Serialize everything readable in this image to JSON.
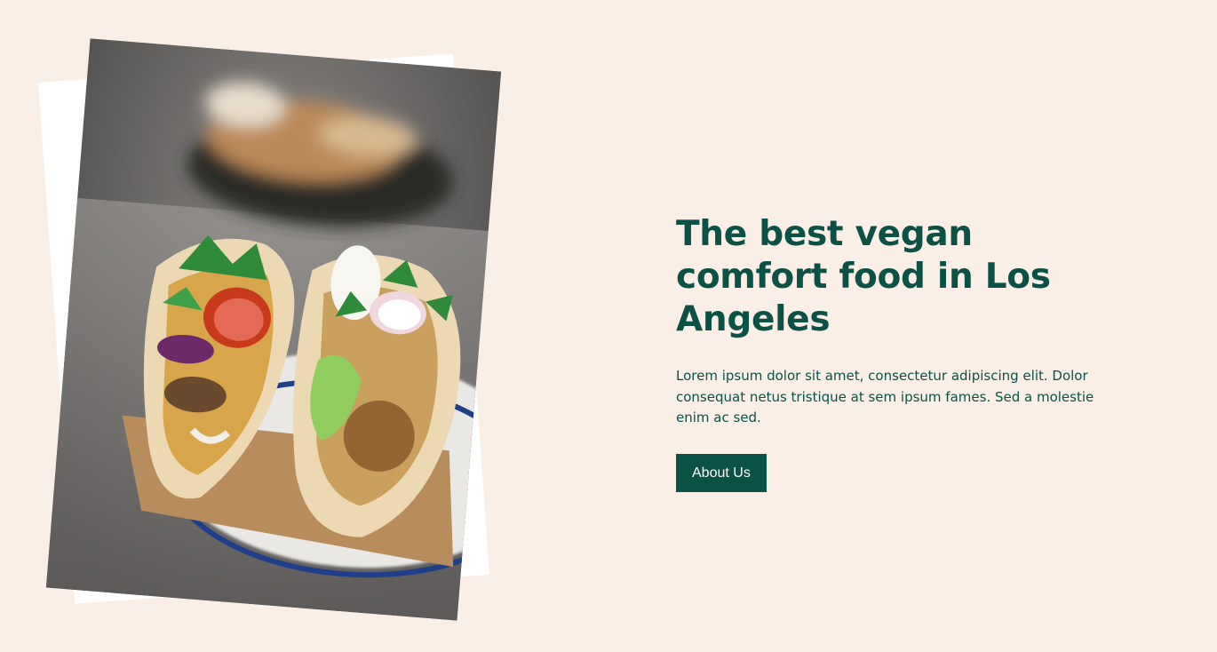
{
  "hero": {
    "headline": "The best vegan comfort food in Los Angeles",
    "body": "Lorem ipsum dolor sit amet, consectetur adipiscing elit. Dolor consequat netus tristique at sem ipsum fames. Sed a molestie enim ac sed.",
    "cta_label": "About Us"
  },
  "colors": {
    "background": "#f9efe6",
    "brand_green": "#0b5145",
    "button_text": "#ffffff"
  }
}
